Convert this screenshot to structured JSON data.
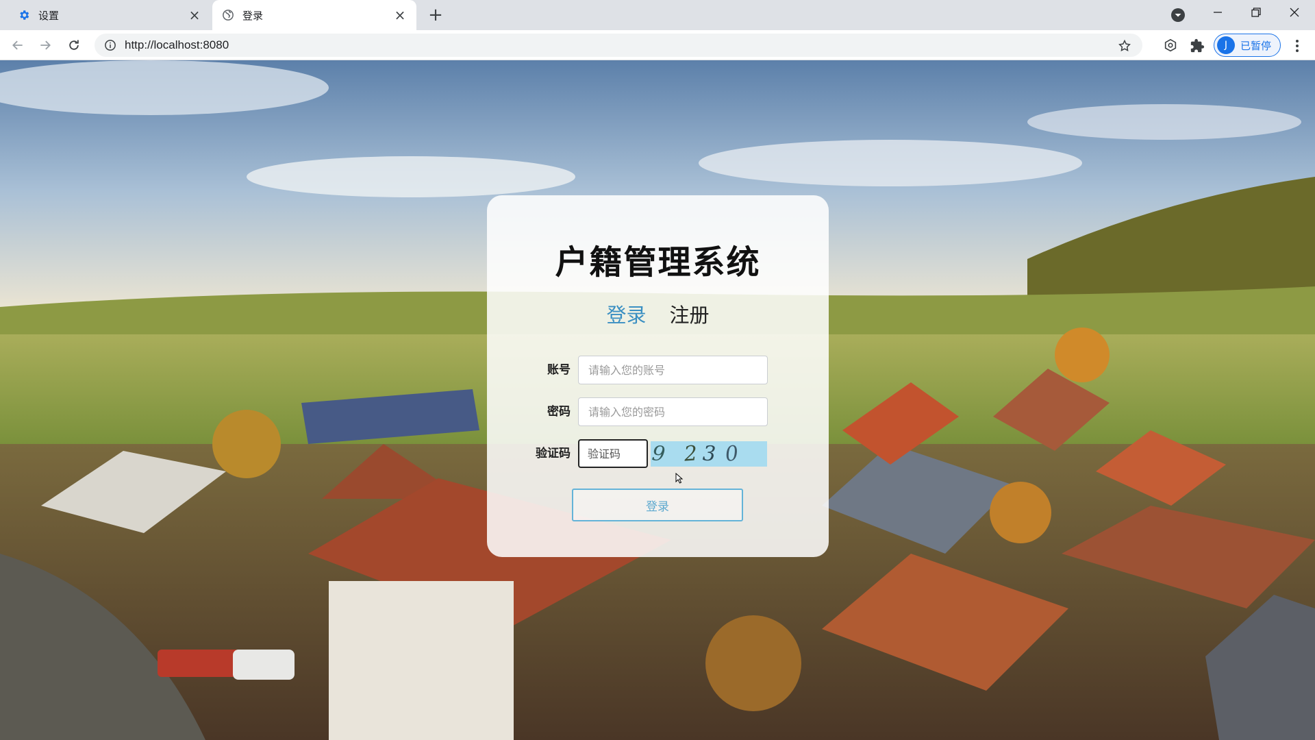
{
  "browser": {
    "tabs": [
      {
        "title": "设置",
        "icon": "gear-icon"
      },
      {
        "title": "登录",
        "icon": "globe-icon"
      }
    ],
    "url": "http://localhost:8080",
    "profile": {
      "initial": "J",
      "label": "已暂停"
    }
  },
  "page": {
    "title": "户籍管理系统",
    "mode_tabs": {
      "login": "登录",
      "register": "注册"
    },
    "form": {
      "account_label": "账号",
      "account_placeholder": "请输入您的账号",
      "password_label": "密码",
      "password_placeholder": "请输入您的密码",
      "captcha_label": "验证码",
      "captcha_placeholder": "验证码",
      "captcha_digits": [
        "9",
        "2",
        "3",
        "0"
      ]
    },
    "login_button": "登录"
  },
  "colors": {
    "accent": "#3a8fc2",
    "captcha_bg": "#a9dcef",
    "profile_blue": "#1a73e8"
  }
}
